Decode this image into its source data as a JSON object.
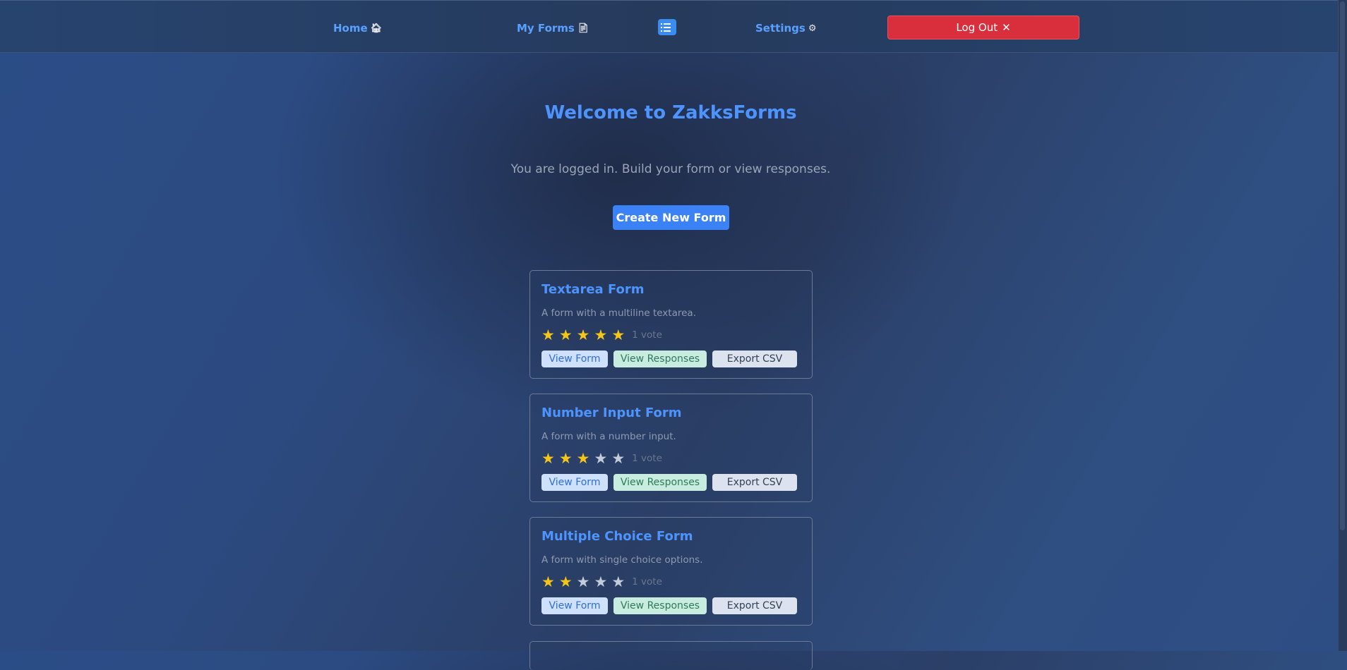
{
  "nav": {
    "home_label": "Home",
    "my_forms_label": "My Forms",
    "settings_label": "Settings",
    "logout_label": "Log Out",
    "brand_icon": "form-list-icon"
  },
  "hero": {
    "title": "Welcome to ZakksForms",
    "subtitle": "You are logged in. Build your form or view responses.",
    "create_button": "Create New Form"
  },
  "colors": {
    "accent": "#4d94ff",
    "logout": "#d92f3c",
    "star_filled": "#f5c518"
  },
  "forms": [
    {
      "title": "Textarea Form",
      "description": "A form with a multiline textarea.",
      "rating": 5,
      "max_rating": 5,
      "votes": "1 vote",
      "view_label": "View Form",
      "responses_label": "View Responses",
      "export_label": "Export CSV"
    },
    {
      "title": "Number Input Form",
      "description": "A form with a number input.",
      "rating": 3,
      "max_rating": 5,
      "votes": "1 vote",
      "view_label": "View Form",
      "responses_label": "View Responses",
      "export_label": "Export CSV"
    },
    {
      "title": "Multiple Choice Form",
      "description": "A form with single choice options.",
      "rating": 2,
      "max_rating": 5,
      "votes": "1 vote",
      "view_label": "View Form",
      "responses_label": "View Responses",
      "export_label": "Export CSV"
    }
  ]
}
